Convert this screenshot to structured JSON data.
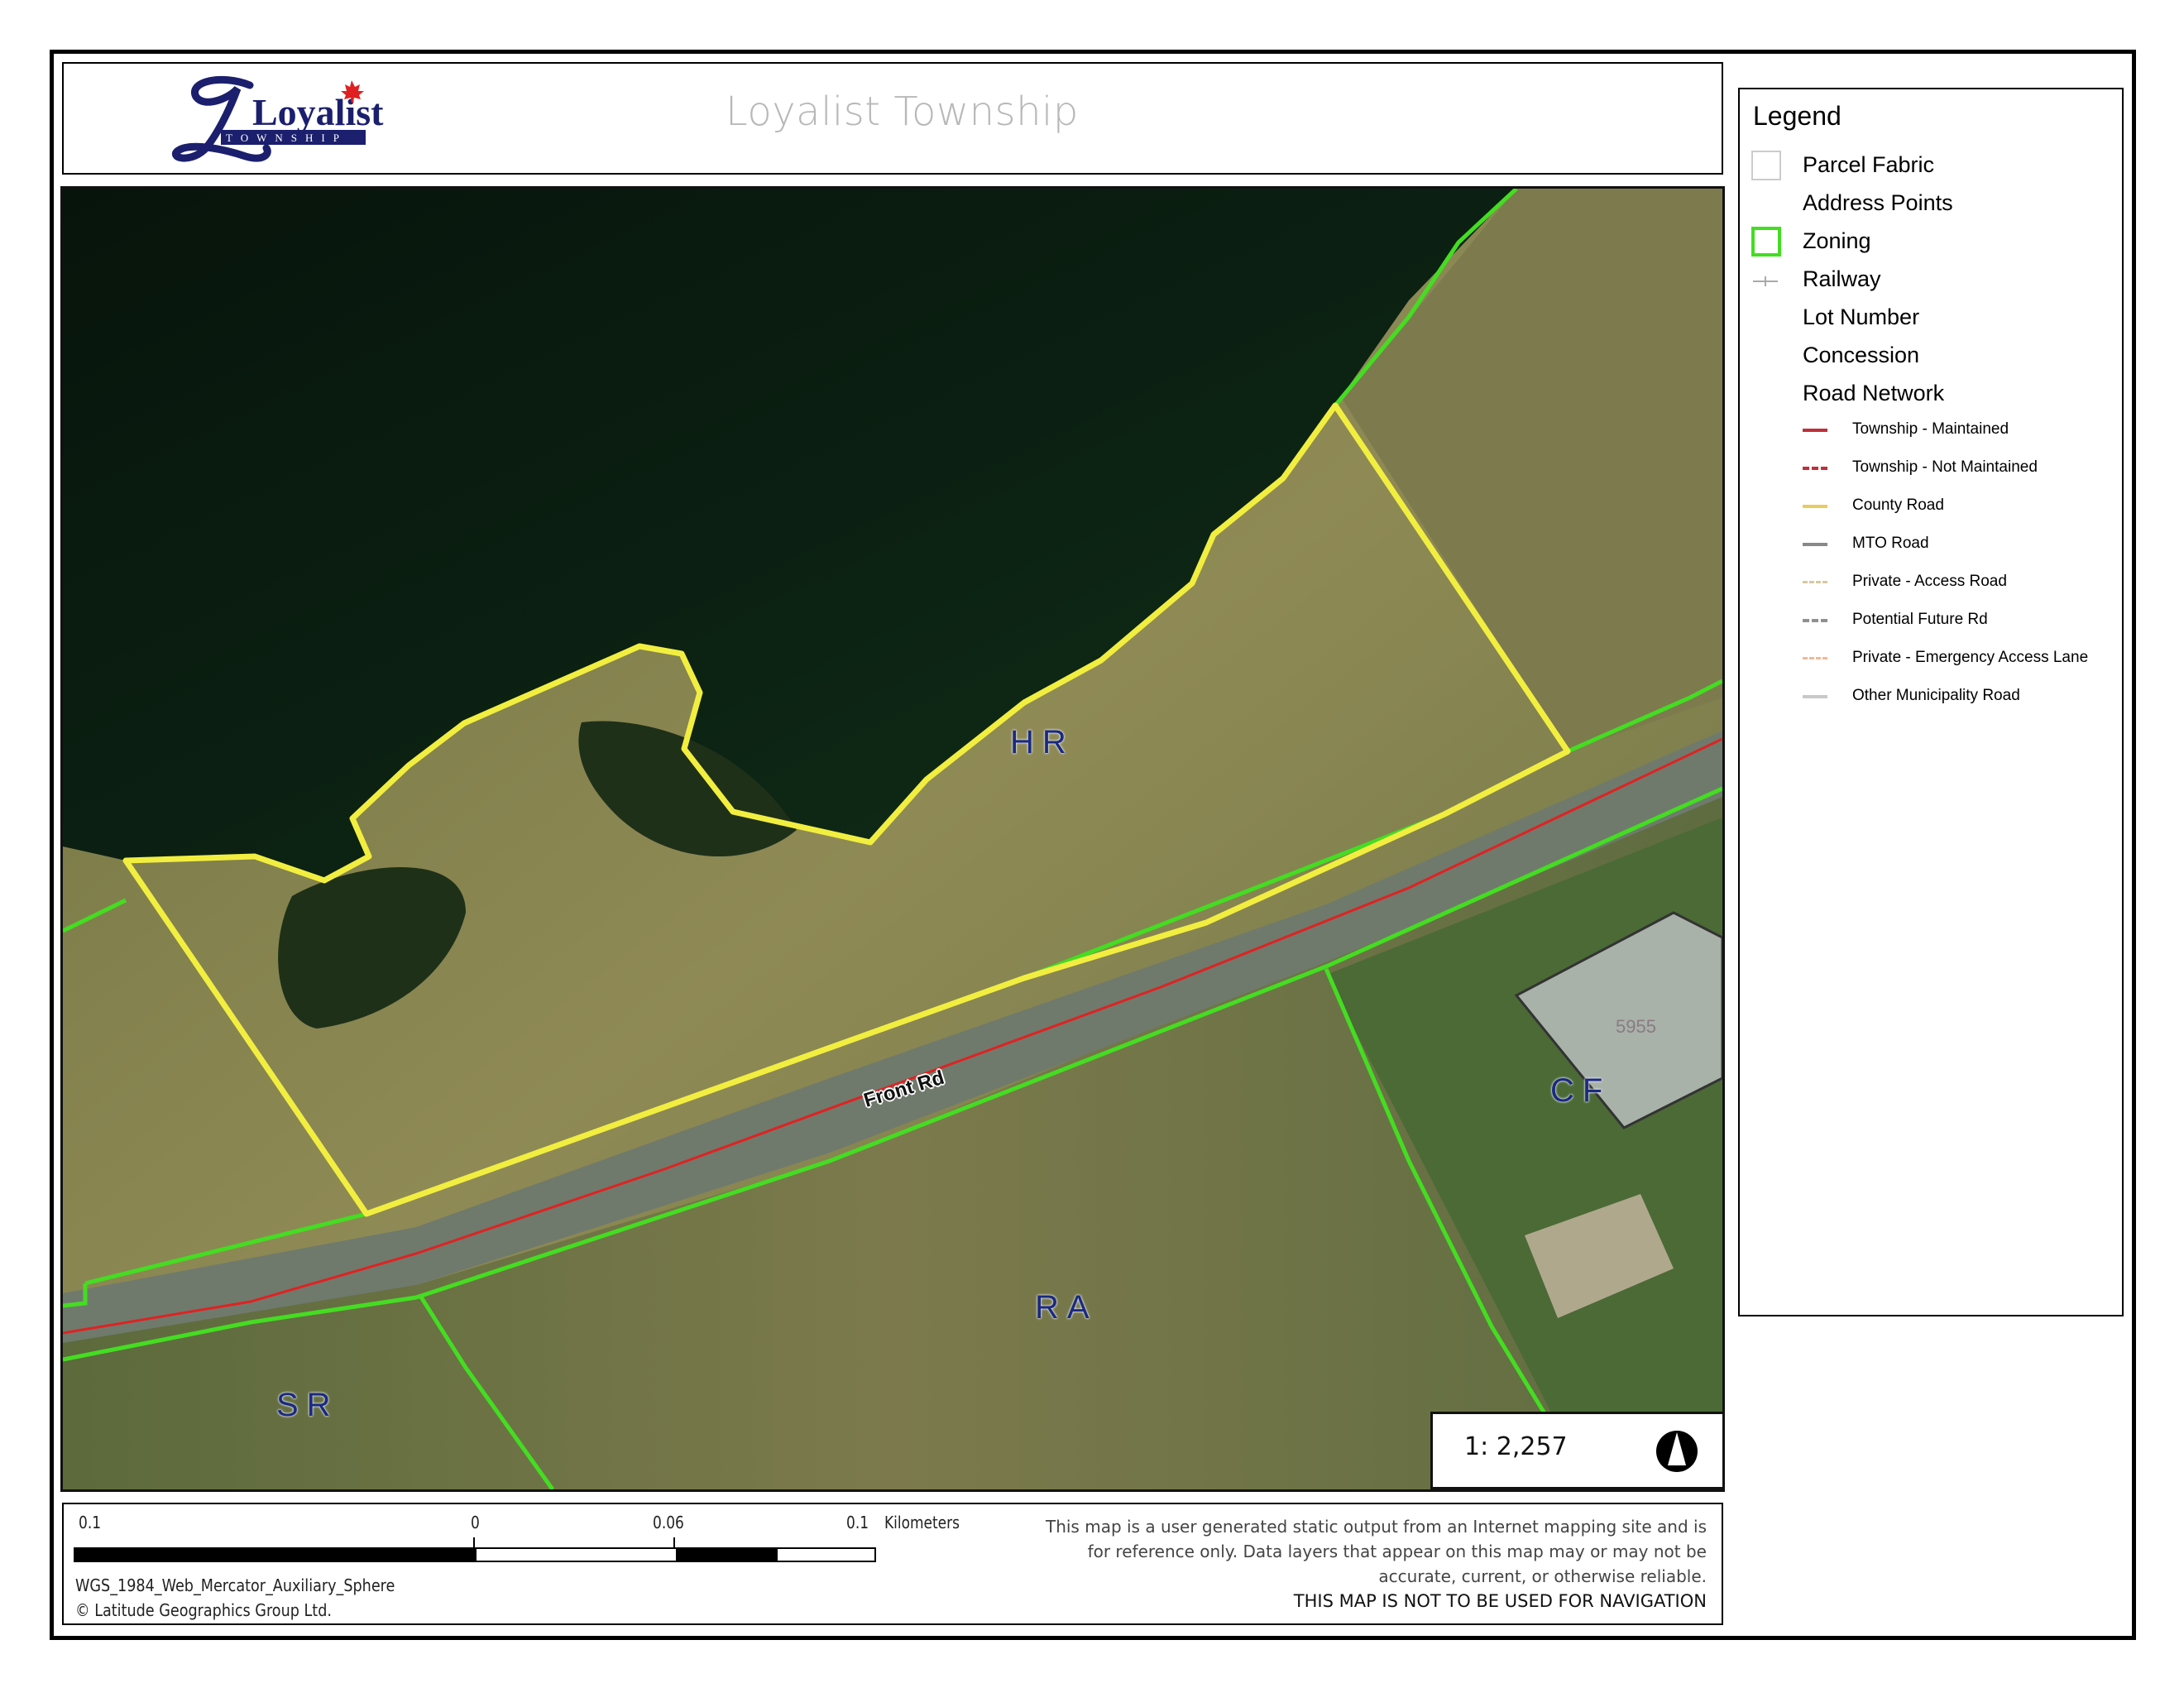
{
  "header": {
    "logo": {
      "script_text": "Loyalist",
      "banner_text": "TOWNSHIP",
      "leaf_color": "#e02020",
      "brand_color": "#1b1f6e"
    },
    "title": "Loyalist Township"
  },
  "map": {
    "zone_labels": [
      {
        "id": "hr",
        "text": "HR"
      },
      {
        "id": "ra",
        "text": "RA"
      },
      {
        "id": "sr",
        "text": "SR"
      },
      {
        "id": "cf",
        "text": "CF"
      }
    ],
    "address_point": "5955",
    "road_label": "Front Rd",
    "colors": {
      "zoning_line": "#44dd22",
      "selected_parcel": "#f2ee40",
      "township_maintained_road": "#e02222"
    },
    "scale": {
      "text": "1: 2,257"
    },
    "north_arrow": "north-arrow-icon"
  },
  "legend": {
    "title": "Legend",
    "items": [
      {
        "label": "Parcel Fabric",
        "symbol": "outlined-square",
        "color": "#cccccc"
      },
      {
        "label": "Address Points",
        "symbol": "none"
      },
      {
        "label": "Zoning",
        "symbol": "outlined-square",
        "color": "#44dd22"
      },
      {
        "label": "Railway",
        "symbol": "railway-line",
        "color": "#aaaaaa"
      },
      {
        "label": "Lot Number",
        "symbol": "none"
      },
      {
        "label": "Concession",
        "symbol": "none"
      },
      {
        "label": "Road Network",
        "symbol": "none"
      }
    ],
    "road_network": [
      {
        "label": "Township - Maintained",
        "style": "solid",
        "color": "#c0303a"
      },
      {
        "label": "Township - Not Maintained",
        "style": "dash-dot",
        "color": "#c0303a"
      },
      {
        "label": "County Road",
        "style": "solid",
        "color": "#e8cc60"
      },
      {
        "label": "MTO Road",
        "style": "solid",
        "color": "#888888"
      },
      {
        "label": "Private - Access Road",
        "style": "dashed",
        "color": "#d8c8a0"
      },
      {
        "label": "Potential Future Rd",
        "style": "dashed-wide",
        "color": "#909090"
      },
      {
        "label": "Private - Emergency Access Lane",
        "style": "dashed",
        "color": "#f0b898"
      },
      {
        "label": "Other Municipality Road",
        "style": "solid",
        "color": "#c8c8c8"
      }
    ]
  },
  "footer": {
    "scalebar": {
      "labels": [
        "0.1",
        "0",
        "0.06",
        "0.1"
      ],
      "units": "Kilometers"
    },
    "projection": "WGS_1984_Web_Mercator_Auxiliary_Sphere",
    "copyright": "© Latitude Geographics Group Ltd.",
    "disclaimer": "This map is a user generated static output from an Internet mapping site and is for reference only. Data layers that appear on this map may or may not be accurate, current, or otherwise reliable.",
    "warning": "THIS MAP IS NOT TO BE USED FOR NAVIGATION"
  }
}
